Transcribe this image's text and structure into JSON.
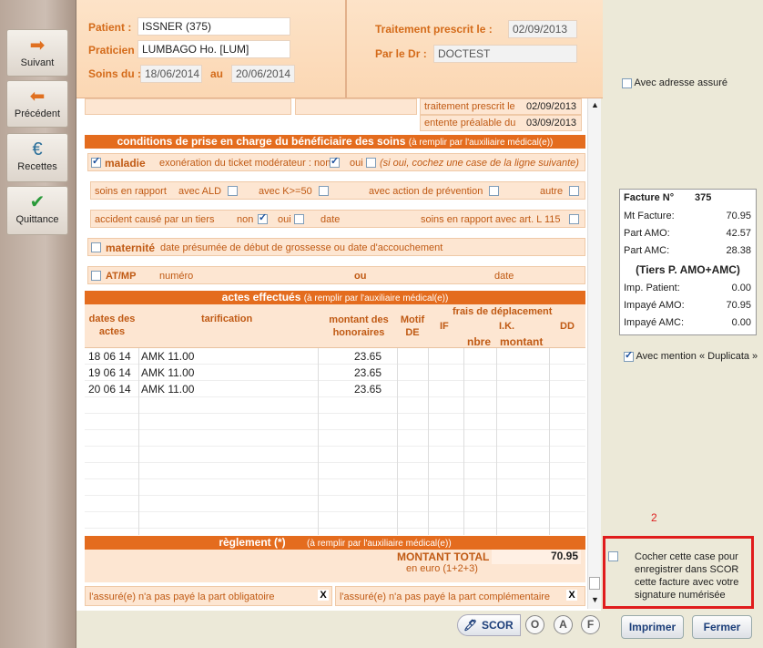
{
  "sidebar": {
    "items": [
      {
        "label": "Suivant",
        "icon": "arrow-right-icon"
      },
      {
        "label": "Précédent",
        "icon": "arrow-left-icon"
      },
      {
        "label": "Recettes",
        "icon": "euro-icon"
      },
      {
        "label": "Quittance",
        "icon": "check-document-icon"
      }
    ]
  },
  "header": {
    "patient_label": "Patient :",
    "patient_value": "ISSNER (375)",
    "praticien_label": "Praticien :",
    "praticien_value": "LUMBAGO Ho. [LUM]",
    "soins_label": "Soins du :",
    "soins_from": "18/06/2014",
    "au_label": "au",
    "soins_to": "20/06/2014",
    "traitement_label": "Traitement prescrit le :",
    "traitement_value": "02/09/2013",
    "par_label": "Par le Dr :",
    "par_value": "DOCTEST"
  },
  "form": {
    "trait_prescrit_label": "traitement prescrit le",
    "trait_prescrit_value": "02/09/2013",
    "entente_label": "entente préalable du",
    "entente_value": "03/09/2013",
    "conditions_title": "conditions de prise en charge du bénéficiaire des soins",
    "conditions_note": "(à remplir par l'auxiliaire médical(e))",
    "maladie": "maladie",
    "exoneration": "exonération du ticket modérateur : non",
    "oui": "oui",
    "exoneration_hint": "(si oui, cochez une case de la ligne suivante)",
    "soins_rapport": "soins en rapport",
    "avec_ald": "avec ALD",
    "avec_k": "avec K>=50",
    "avec_prevention": "avec action de prévention",
    "autre": "autre",
    "accident": "accident causé par un tiers",
    "non": "non",
    "oui2": "oui",
    "date": "date",
    "art_l115": "soins en rapport avec art. L 115",
    "maternite": "maternité",
    "maternite_desc": "date présumée de début de grossesse ou date d'accouchement",
    "atmp": "AT/MP",
    "numero": "numéro",
    "ou": "ou",
    "date2": "date",
    "actes_title": "actes effectués",
    "actes_note": "(à remplir par l'auxiliaire médical(e))",
    "col_dates": "dates des actes",
    "col_tarif": "tarification",
    "col_montant": "montant des honoraires",
    "col_motif": "Motif DE",
    "col_frais": "frais de déplacement",
    "col_if": "IF",
    "col_ik": "I.K.",
    "col_dd": "DD",
    "col_nbre": "nbre",
    "col_montant2": "montant",
    "rows": [
      {
        "date": "18 06 14",
        "tarif": "AMK 11.00",
        "montant": "23.65"
      },
      {
        "date": "19 06 14",
        "tarif": "AMK 11.00",
        "montant": "23.65"
      },
      {
        "date": "20 06 14",
        "tarif": "AMK 11.00",
        "montant": "23.65"
      }
    ],
    "reglement_title": "règlement (*)",
    "reglement_note": "(à remplir par l'auxiliaire médical(e))",
    "montant_total_label": "MONTANT TOTAL",
    "montant_total_value": "70.95",
    "en_euro": "en euro (1+2+3)",
    "pas_paye_oblig": "l'assuré(e) n'a pas payé la part obligatoire",
    "pas_paye_compl": "l'assuré(e) n'a pas payé la part complémentaire",
    "x": "X"
  },
  "right": {
    "avec_adresse": "Avec adresse assuré",
    "facture_label": "Facture N°",
    "facture_num": "375",
    "lines": [
      {
        "label": "Mt Facture:",
        "value": "70.95"
      },
      {
        "label": "Part AMO:",
        "value": "42.57"
      },
      {
        "label": "Part AMC:",
        "value": "28.38"
      }
    ],
    "tiers": "(Tiers P. AMO+AMC)",
    "lines2": [
      {
        "label": "Imp. Patient:",
        "value": "0.00"
      },
      {
        "label": "Impayé AMO:",
        "value": "70.95"
      },
      {
        "label": "Impayé AMC:",
        "value": "0.00"
      }
    ],
    "duplicata": "Avec mention « Duplicata »",
    "annotation": "2",
    "scor_text": "Cocher cette case pour enregistrer dans SCOR cette facture avec votre signature numérisée"
  },
  "footer": {
    "scor": "SCOR",
    "o": "O",
    "a": "A",
    "f": "F",
    "imprimer": "Imprimer",
    "fermer": "Fermer"
  }
}
